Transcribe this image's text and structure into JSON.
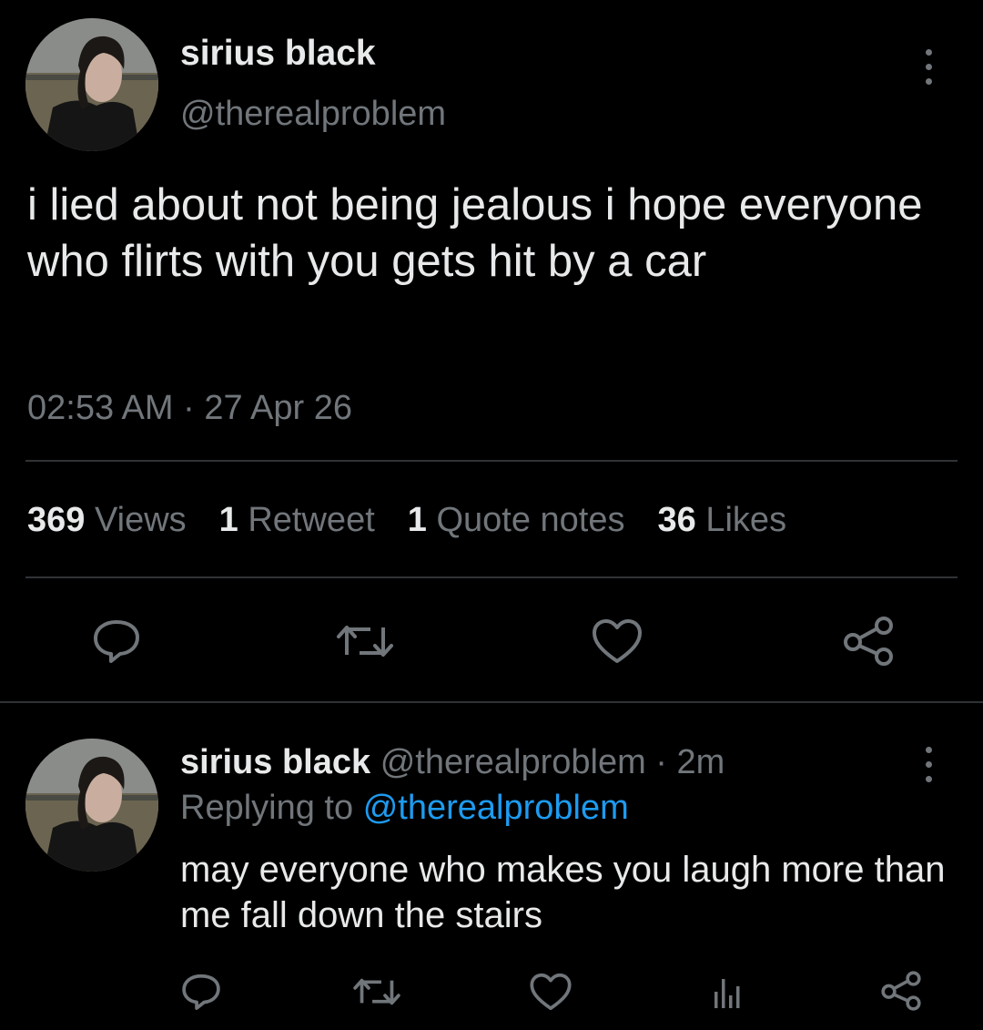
{
  "main_tweet": {
    "display_name": "sirius black",
    "handle": "@therealproblem",
    "text": "i lied about not being jealous i hope everyone who flirts with you gets hit by a car",
    "timestamp": "02:53 AM · 27 Apr 26",
    "stats": {
      "views_count": "369",
      "views_label": "Views",
      "retweets_count": "1",
      "retweets_label": "Retweet",
      "quotes_count": "1",
      "quotes_label": "Quote notes",
      "likes_count": "36",
      "likes_label": "Likes"
    },
    "actions": [
      "reply-icon",
      "retweet-icon",
      "heart-icon",
      "share-icon"
    ]
  },
  "reply_tweet": {
    "display_name": "sirius black",
    "handle_time": "@therealproblem · 2m",
    "replying_prefix": "Replying to",
    "replying_handle": "@therealproblem",
    "text": "may everyone who makes you laugh more than me fall down the stairs",
    "actions": [
      "reply-icon",
      "retweet-icon",
      "heart-icon",
      "analytics-icon",
      "share-icon"
    ]
  },
  "colors": {
    "background": "#000000",
    "text": "#e7e9ea",
    "muted": "#71767b",
    "link": "#1d9bf0",
    "divider": "#2f3336"
  }
}
